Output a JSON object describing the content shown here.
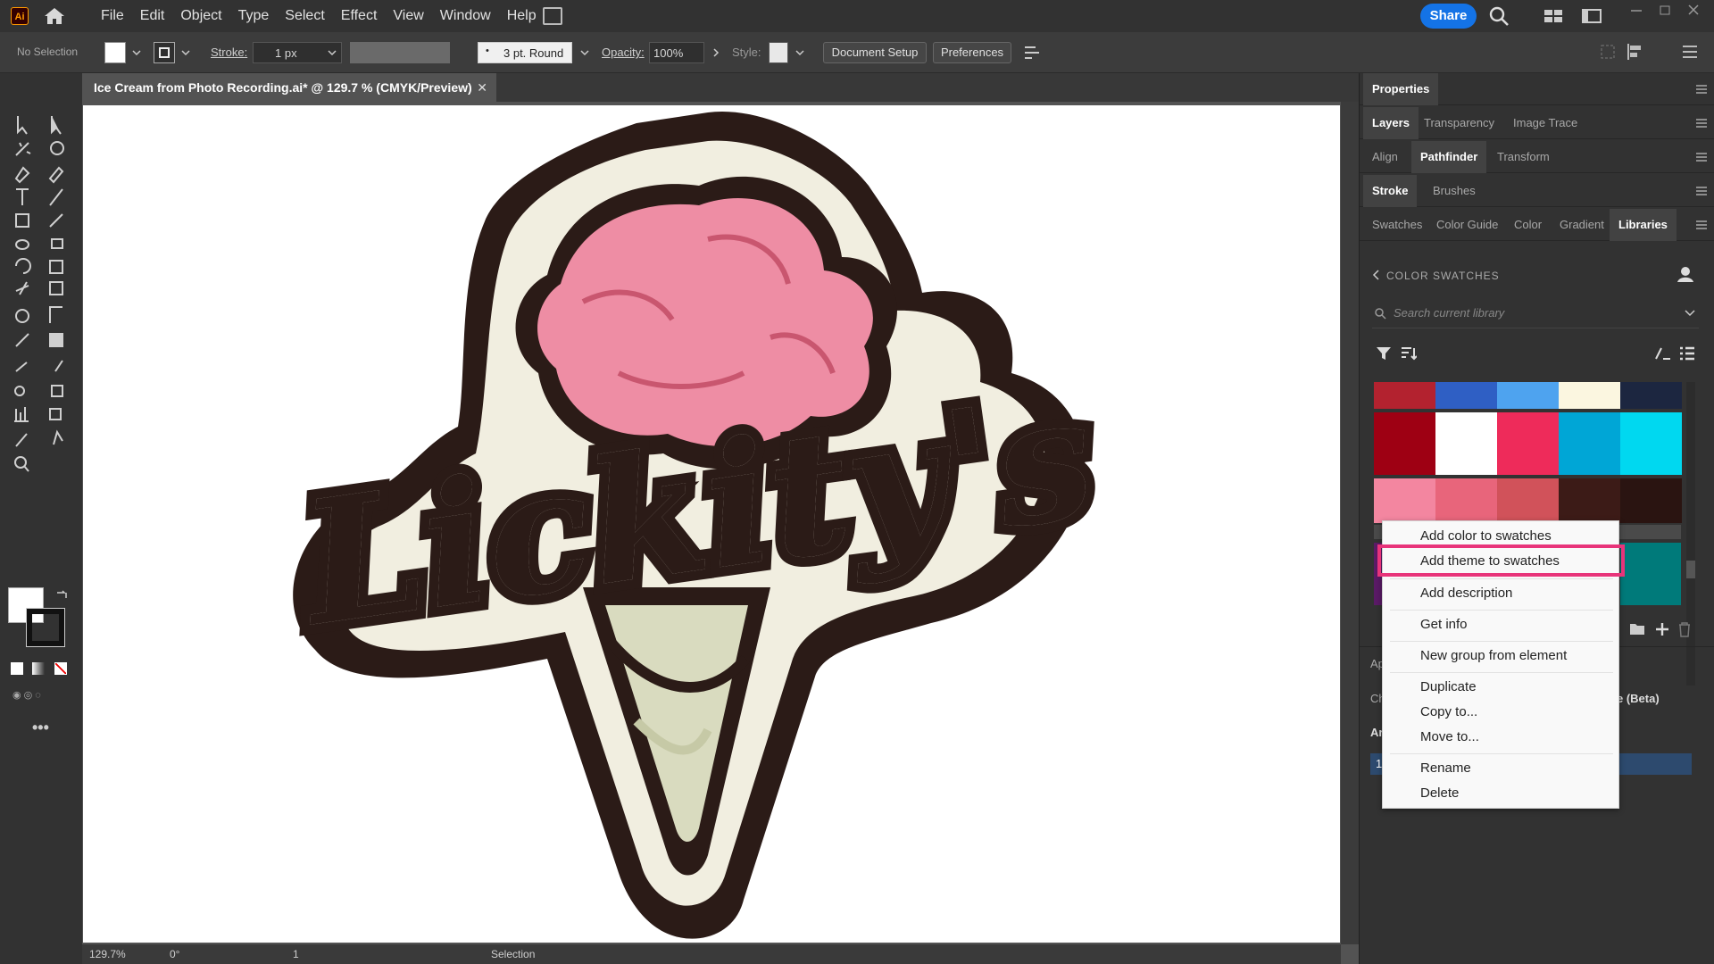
{
  "app": {
    "icon_label": "Ai",
    "title_doc": "Ice Cream from Photo Recording.ai* @ 129.7 % (CMYK/Preview)"
  },
  "menubar": {
    "items": [
      "File",
      "Edit",
      "Object",
      "Type",
      "Select",
      "Effect",
      "View",
      "Window",
      "Help"
    ],
    "share_label": "Share"
  },
  "control": {
    "selection_label": "No Selection",
    "stroke_label": "Stroke:",
    "stroke_value": "1 px",
    "brush_value": "3 pt. Round",
    "opacity_label": "Opacity:",
    "opacity_value": "100%",
    "style_label": "Style:",
    "doc_setup_label": "Document Setup",
    "preferences_label": "Preferences"
  },
  "status": {
    "zoom": "129.7%",
    "rotation": "0°",
    "artboard": "1",
    "tool": "Selection"
  },
  "panels": {
    "row1": [
      {
        "label": "Properties",
        "active": true
      }
    ],
    "row2": [
      {
        "label": "Layers",
        "active": true
      },
      {
        "label": "Transparency"
      },
      {
        "label": "Image Trace"
      }
    ],
    "row3": [
      {
        "label": "Align"
      },
      {
        "label": "Pathfinder",
        "active": true
      },
      {
        "label": "Transform"
      }
    ],
    "row4": [
      {
        "label": "Stroke",
        "active": true
      },
      {
        "label": "Brushes"
      }
    ],
    "row5": [
      {
        "label": "Swatches"
      },
      {
        "label": "Color Guide"
      },
      {
        "label": "Color"
      },
      {
        "label": "Gradient"
      },
      {
        "label": "Libraries",
        "active": true
      }
    ],
    "section_title": "COLOR SWATCHES",
    "search_placeholder": "Search current library",
    "partial_labels": {
      "ap": "Ap",
      "ch": "Ch",
      "ar": "Ar",
      "beta": "e (Beta)",
      "artboard_num": "1"
    }
  },
  "swatch_rows": [
    [
      "#b3222f",
      "#2f5fc4",
      "#4ea3ef",
      "#fbf6e0",
      "#1c2640"
    ],
    [
      "#9e0013",
      "#ffffff",
      "#ee2b5a",
      "#00a6d6",
      "#00d8f0"
    ],
    [
      "#f386a0",
      "#e8657b",
      "#d1525a",
      "#3c1b17",
      "#2a1411"
    ]
  ],
  "context_menu": {
    "items": [
      "Add color to swatches",
      "Add theme to swatches",
      "Add description",
      "Get info",
      "New group from element",
      "Duplicate",
      "Copy to...",
      "Move to...",
      "Rename",
      "Delete"
    ],
    "highlighted": "Add theme to swatches"
  },
  "artwork": {
    "wordmark": "Lickity's"
  },
  "colors": {
    "outline": "#2b1b17",
    "cream": "#f1eee0",
    "pink": "#ee8da4",
    "cone": "#d9dbbf",
    "highlight": "#e8347a",
    "share": "#1473e6"
  }
}
